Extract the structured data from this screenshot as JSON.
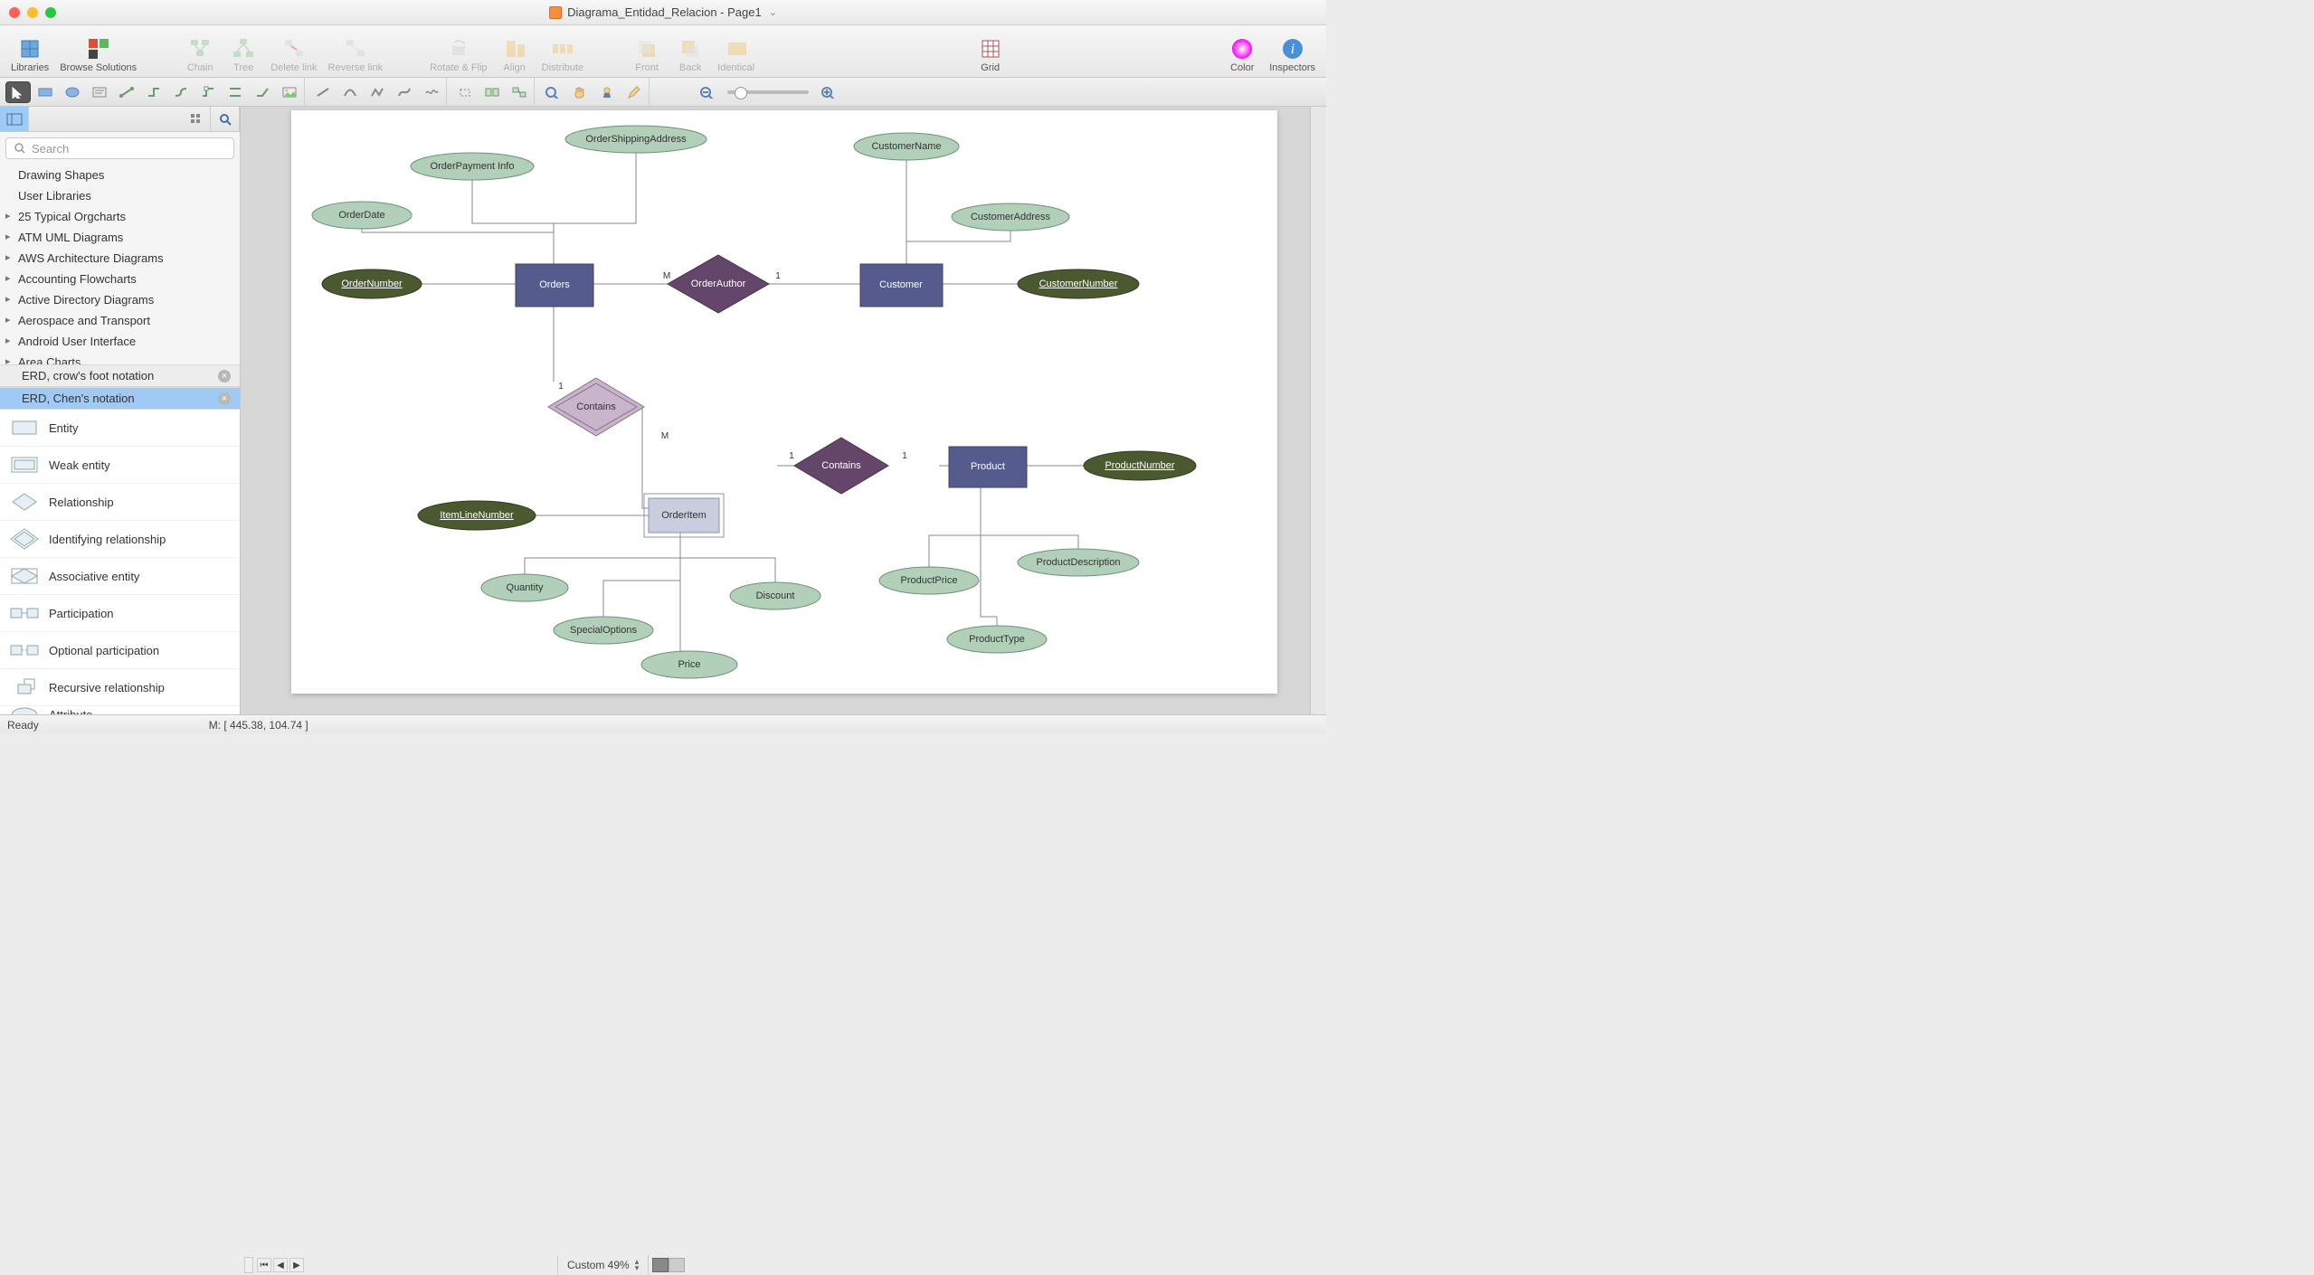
{
  "window": {
    "title": "Diagrama_Entidad_Relacion - Page1"
  },
  "toolbar": {
    "libraries": "Libraries",
    "browse": "Browse Solutions",
    "chain": "Chain",
    "tree": "Tree",
    "delete_link": "Delete link",
    "reverse_link": "Reverse link",
    "rotate_flip": "Rotate & Flip",
    "align": "Align",
    "distribute": "Distribute",
    "front": "Front",
    "back": "Back",
    "identical": "Identical",
    "grid": "Grid",
    "color": "Color",
    "inspectors": "Inspectors"
  },
  "sidebar": {
    "search_placeholder": "Search",
    "sections": {
      "drawing_shapes": "Drawing Shapes",
      "user_libraries": "User Libraries",
      "orgcharts": "25 Typical Orgcharts",
      "atm": "ATM UML Diagrams",
      "aws": "AWS Architecture Diagrams",
      "accounting": "Accounting Flowcharts",
      "ad": "Active Directory Diagrams",
      "aerospace": "Aerospace and Transport",
      "android": "Android User Interface",
      "area": "Area Charts"
    },
    "tabs": {
      "crows": "ERD, crow's foot notation",
      "chens": "ERD, Chen's notation"
    },
    "stencils": {
      "entity": "Entity",
      "weak": "Weak entity",
      "relationship": "Relationship",
      "identifying": "Identifying relationship",
      "associative": "Associative entity",
      "participation": "Participation",
      "optional": "Optional participation",
      "recursive": "Recursive relationship",
      "attribute": "Attribute"
    }
  },
  "erd": {
    "entities": {
      "orders": "Orders",
      "customer": "Customer",
      "orderitem": "OrderItem",
      "product": "Product"
    },
    "relationships": {
      "orderauthor": "OrderAuthor",
      "contains1": "Contains",
      "contains2": "Contains"
    },
    "attributes": {
      "order_date": "OrderDate",
      "order_payment": "OrderPayment Info",
      "order_shipping": "OrderShippingAddress",
      "order_number": "OrderNumber",
      "customer_name": "CustomerName",
      "customer_address": "CustomerAddress",
      "customer_number": "CustomerNumber",
      "item_line_number": "ItemLineNumber",
      "quantity": "Quantity",
      "special_options": "SpecialOptions",
      "price": "Price",
      "discount": "Discount",
      "product_number": "ProductNumber",
      "product_description": "ProductDescription",
      "product_price": "ProductPrice",
      "product_type": "ProductType"
    },
    "cardinality": {
      "m": "M",
      "one": "1"
    }
  },
  "status": {
    "ready": "Ready",
    "zoom": "Custom 49%",
    "coord": "M: [ 445.38, 104.74 ]"
  }
}
